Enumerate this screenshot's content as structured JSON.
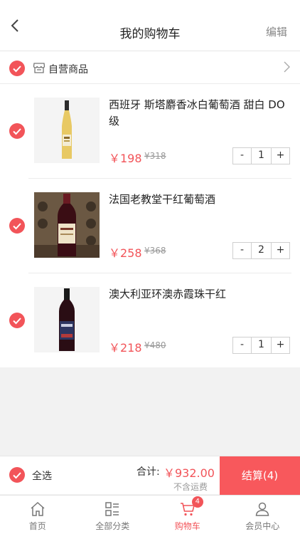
{
  "header": {
    "title": "我的购物车",
    "edit_label": "编辑"
  },
  "shop": {
    "name": "自营商品"
  },
  "items": [
    {
      "name": "西班牙 斯塔麝香冰白葡萄酒 甜白 DO级",
      "price": "￥198",
      "original_price": "¥318",
      "quantity": "1",
      "image": "white-wine-bottle"
    },
    {
      "name": "法国老教堂干红葡萄酒",
      "price": "￥258",
      "original_price": "¥368",
      "quantity": "2",
      "image": "red-wine-bottle-in-cellar"
    },
    {
      "name": "澳大利亚环澳赤霞珠干红",
      "price": "￥218",
      "original_price": "¥480",
      "quantity": "1",
      "image": "red-wine-bottle"
    }
  ],
  "stepper": {
    "minus": "-",
    "plus": "+"
  },
  "footer": {
    "select_all": "全选",
    "total_label": "合计:",
    "total_value": "￥932.00",
    "shipping_note": "不含运费",
    "checkout_label": "结算(4)"
  },
  "tabbar": {
    "tabs": [
      {
        "label": "首页",
        "icon": "home-icon"
      },
      {
        "label": "全部分类",
        "icon": "category-icon"
      },
      {
        "label": "购物车",
        "icon": "cart-icon",
        "badge": "4",
        "active": true
      },
      {
        "label": "会员中心",
        "icon": "user-icon"
      }
    ]
  },
  "colors": {
    "accent": "#f25459",
    "checkout_bg": "#f8585c",
    "background": "#f2f2f2"
  }
}
